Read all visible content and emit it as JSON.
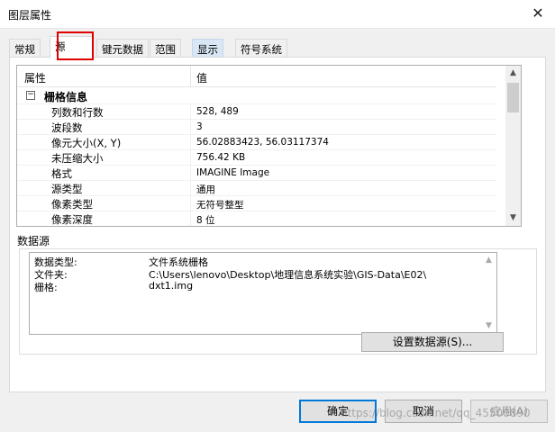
{
  "window": {
    "title": "图层属性",
    "close_glyph": "✕"
  },
  "tabs": [
    {
      "label": "常规"
    },
    {
      "label": "源"
    },
    {
      "label": "键元数据"
    },
    {
      "label": "范围"
    },
    {
      "label": "显示"
    },
    {
      "label": "符号系统"
    }
  ],
  "property_grid": {
    "col_property": "属性",
    "col_value": "值",
    "category": {
      "toggle": "−",
      "label": "栅格信息"
    },
    "rows": [
      {
        "name": "列数和行数",
        "value": "528, 489"
      },
      {
        "name": "波段数",
        "value": "3"
      },
      {
        "name": "像元大小(X, Y)",
        "value": "56.02883423, 56.03117374"
      },
      {
        "name": "未压缩大小",
        "value": "756.42 KB"
      },
      {
        "name": "格式",
        "value": "IMAGINE Image"
      },
      {
        "name": "源类型",
        "value": "通用"
      },
      {
        "name": "像素类型",
        "value": "无符号整型"
      },
      {
        "name": "像素深度",
        "value": "8 位"
      }
    ],
    "scroll_up": "▲",
    "scroll_down": "▼"
  },
  "data_source": {
    "label": "数据源",
    "rows": [
      {
        "key": "数据类型:",
        "value": "文件系统栅格"
      },
      {
        "key": "文件夹:",
        "value": "C:\\Users\\lenovo\\Desktop\\地理信息系统实验\\GIS-Data\\E02\\"
      },
      {
        "key": "栅格:",
        "value": "dxt1.img"
      }
    ],
    "scroll_up": "▲",
    "scroll_down": "▼",
    "set_button": "设置数据源(S)..."
  },
  "footer": {
    "ok": "确定",
    "cancel": "取消",
    "apply": "应用(A)"
  },
  "watermark": "https://blog.csdn.net/qq_45500890",
  "colors": {
    "annotation": "#e00000",
    "focus": "#0078d7"
  }
}
